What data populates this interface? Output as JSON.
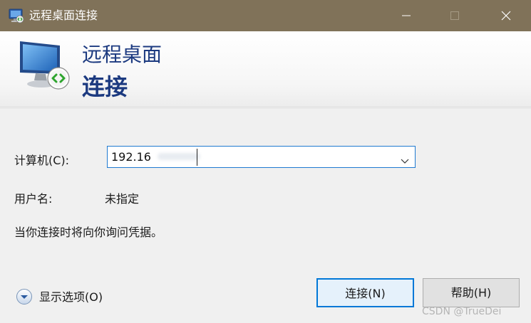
{
  "window": {
    "title": "远程桌面连接"
  },
  "header": {
    "line1": "远程桌面",
    "line2": "连接"
  },
  "form": {
    "computer_label": "计算机(C):",
    "computer_value": "192.16",
    "username_label": "用户名:",
    "username_value": "未指定",
    "hint": "当你连接时将向你询问凭据。"
  },
  "options": {
    "label": "显示选项(O)"
  },
  "buttons": {
    "connect": "连接(N)",
    "help": "帮助(H)"
  },
  "watermark": "CSDN @TrueDei",
  "colors": {
    "titlebar": "#807259",
    "header_text": "#1c3a80",
    "focus_border": "#0078d7"
  },
  "icons": [
    "remote-desktop-icon",
    "minimize-icon",
    "maximize-icon",
    "close-icon",
    "monitor-icon",
    "chevron-down-icon",
    "expand-options-icon"
  ]
}
